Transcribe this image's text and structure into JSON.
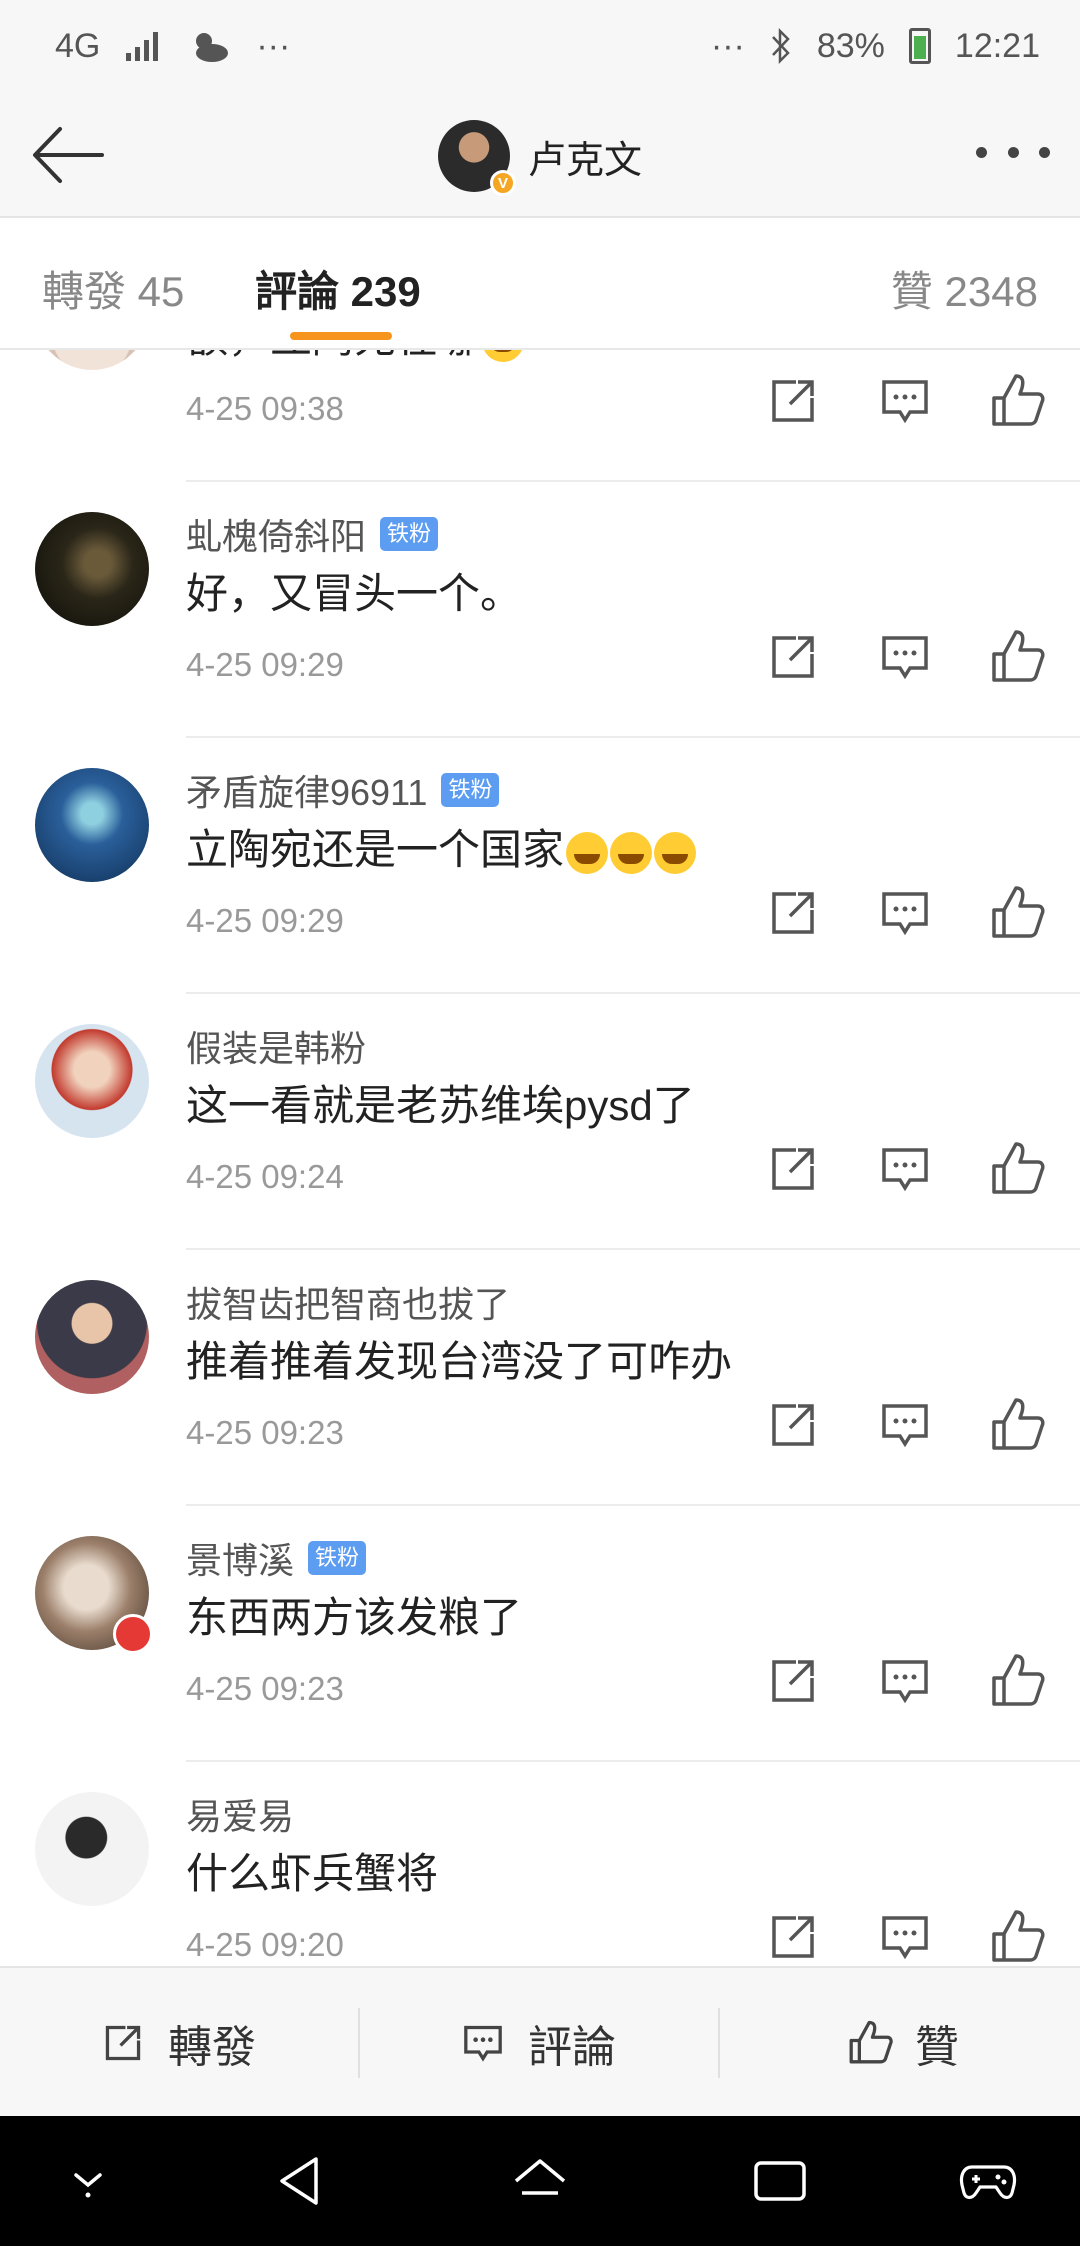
{
  "status_bar": {
    "network": "4G",
    "more": "···",
    "right_more": "···",
    "battery": "83%",
    "time": "12:21"
  },
  "header": {
    "title": "卢克文"
  },
  "tabs": {
    "repost": "轉發 45",
    "comment": "評論 239",
    "like": "贊 2348"
  },
  "comments": [
    {
      "name": "",
      "badge": "",
      "text": "额，立陶宛在哪",
      "emoji_count": 1,
      "time": "4-25 09:38"
    },
    {
      "name": "虬槐倚斜阳",
      "badge": "铁粉",
      "text": "好，又冒头一个。",
      "emoji_count": 0,
      "time": "4-25 09:29"
    },
    {
      "name": "矛盾旋律96911",
      "badge": "铁粉",
      "text": "立陶宛还是一个国家",
      "emoji_count": 3,
      "time": "4-25 09:29"
    },
    {
      "name": "假装是韩粉",
      "badge": "",
      "text": "这一看就是老苏维埃pysd了",
      "emoji_count": 0,
      "time": "4-25 09:24"
    },
    {
      "name": "拔智齿把智商也拔了",
      "badge": "",
      "text": "推着推着发现台湾没了可咋办",
      "emoji_count": 0,
      "time": "4-25 09:23"
    },
    {
      "name": "景博溪",
      "badge": "铁粉",
      "text": "东西两方该发粮了",
      "emoji_count": 0,
      "time": "4-25 09:23"
    },
    {
      "name": "易爱易",
      "badge": "",
      "text": "什么虾兵蟹将",
      "emoji_count": 0,
      "time": "4-25 09:20"
    }
  ],
  "bottom_bar": {
    "repost": "轉發",
    "comment": "評論",
    "like": "贊"
  },
  "colors": {
    "accent_orange": "#f7941d",
    "badge_blue": "#5c9df2",
    "bar_gray": "#f7f7f7"
  }
}
